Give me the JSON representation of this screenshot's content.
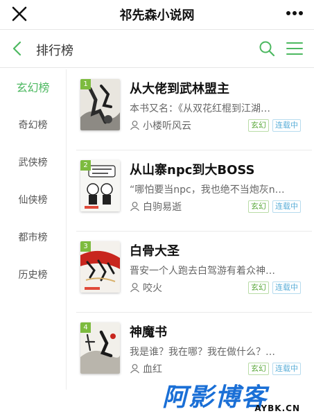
{
  "header": {
    "title": "祁先森小说网",
    "close_icon": "close-icon",
    "more_icon": "more-icon"
  },
  "subheader": {
    "title": "排行榜",
    "back_icon": "back-icon",
    "search_icon": "search-icon",
    "menu_icon": "menu-icon"
  },
  "sidebar": {
    "items": [
      {
        "label": "玄幻榜",
        "active": true
      },
      {
        "label": "奇幻榜",
        "active": false
      },
      {
        "label": "武侠榜",
        "active": false
      },
      {
        "label": "仙侠榜",
        "active": false
      },
      {
        "label": "都市榜",
        "active": false
      },
      {
        "label": "历史榜",
        "active": false
      }
    ]
  },
  "books": [
    {
      "rank": "1",
      "title": "从大佬到武林盟主",
      "desc": "本书又名：《从双花红棍到江湖…",
      "author": "小楼听风云",
      "genre": "玄幻",
      "status": "连载中"
    },
    {
      "rank": "2",
      "title": "从山寨npc到大BOSS",
      "desc": "“哪怕要当npc，我也绝不当炮灰n…",
      "author": "白驹易逝",
      "genre": "玄幻",
      "status": "连载中"
    },
    {
      "rank": "3",
      "title": "白骨大圣",
      "desc": "晋安一个人跑去白驾游有着众神…",
      "author": "咬火",
      "genre": "玄幻",
      "status": "连载中"
    },
    {
      "rank": "4",
      "title": "神魔书",
      "desc": "我是谁？我在哪？我在做什么？…",
      "author": "血红",
      "genre": "玄幻",
      "status": "连载中"
    }
  ],
  "watermark": {
    "main": "阿影博客",
    "sub": "AYBK.CN"
  },
  "colors": {
    "accent": "#4cb860",
    "rank_badge": "#7dbb3f",
    "genre_tag": "#5aa83a",
    "status_tag": "#5aaed8",
    "watermark": "#1a6fd6"
  }
}
